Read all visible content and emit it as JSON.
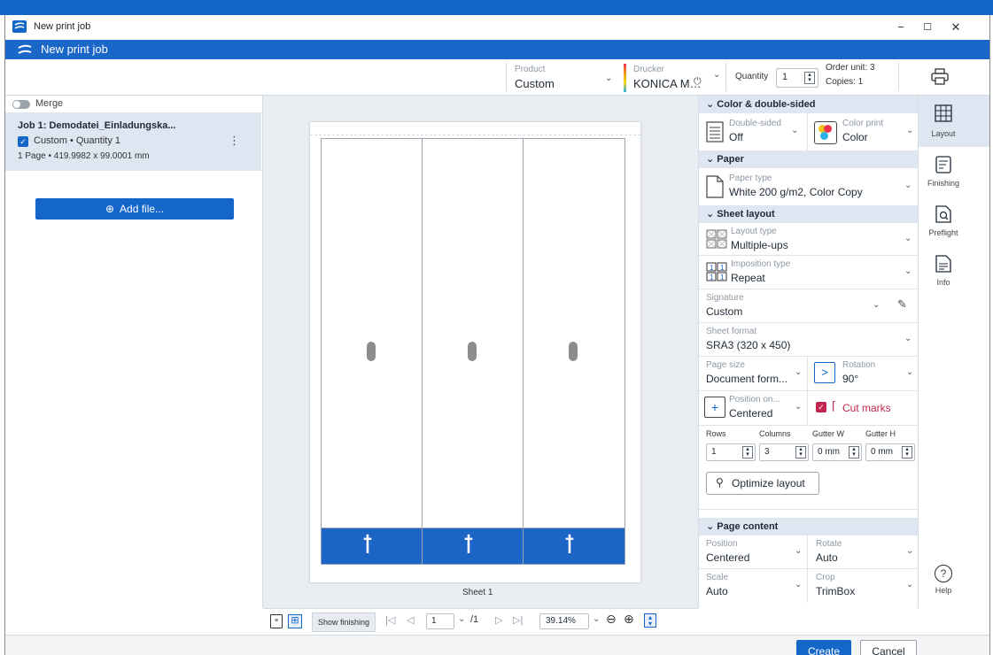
{
  "window": {
    "title": "New print job",
    "minimize": "−",
    "maximize": "☐",
    "close": "✕"
  },
  "appbar": {
    "title": "New print job"
  },
  "toolbar": {
    "product_label": "Product",
    "product_value": "Custom",
    "printer_label": "Drucker",
    "printer_value": "KONICA M…",
    "quantity_label": "Quantity",
    "quantity_value": "1",
    "order_unit": "Order unit: 3",
    "copies": "Copies: 1"
  },
  "left": {
    "merge_label": "Merge",
    "job_title": "Job 1: Demodatei_Einladungska...",
    "job_meta": "Custom • Quantity 1",
    "job_detail": "1 Page • 419.9982 x 99.0001 mm",
    "add_file": "Add file..."
  },
  "preview": {
    "sheet_label": "Sheet 1",
    "show_finishing": "Show finishing",
    "page_value": "1",
    "page_total": "/1",
    "zoom": "39.14%",
    "logo_glyph": "ꝉ"
  },
  "panel": {
    "color_section": "Color & double-sided",
    "double_sided_label": "Double-sided",
    "double_sided_value": "Off",
    "color_print_label": "Color print",
    "color_print_value": "Color",
    "paper_section": "Paper",
    "paper_type_label": "Paper type",
    "paper_type_value": "White 200 g/m2, Color Copy",
    "sheet_layout_section": "Sheet layout",
    "layout_type_label": "Layout type",
    "layout_type_value": "Multiple-ups",
    "imposition_label": "Imposition type",
    "imposition_value": "Repeat",
    "signature_label": "Signature",
    "signature_value": "Custom",
    "sheet_format_label": "Sheet format",
    "sheet_format_value": "SRA3 (320 x 450)",
    "page_size_label": "Page size",
    "page_size_value": "Document form...",
    "rotation_label": "Rotation",
    "rotation_value": "90°",
    "position_on_label": "Position on...",
    "position_on_value": "Centered",
    "cut_marks_label": "Cut marks",
    "rows_label": "Rows",
    "rows_value": "1",
    "columns_label": "Columns",
    "columns_value": "3",
    "gutter_w_label": "Gutter W",
    "gutter_w_value": "0 mm",
    "gutter_h_label": "Gutter H",
    "gutter_h_value": "0 mm",
    "optimize_label": "Optimize layout",
    "page_content_section": "Page content",
    "position_label": "Position",
    "position_value": "Centered",
    "rotate_label": "Rotate",
    "rotate_value": "Auto",
    "scale_label": "Scale",
    "scale_value": "Auto",
    "crop_label": "Crop",
    "crop_value": "TrimBox"
  },
  "sidebar": {
    "items": [
      {
        "label": "Layout"
      },
      {
        "label": "Finishing"
      },
      {
        "label": "Preflight"
      },
      {
        "label": "Info"
      }
    ],
    "help_label": "Help"
  },
  "footer": {
    "create": "Create",
    "cancel": "Cancel"
  },
  "colors": {
    "accent": "#1566c9",
    "header_bg": "#dde6f1",
    "preview_bg": "#e9ecf0"
  }
}
